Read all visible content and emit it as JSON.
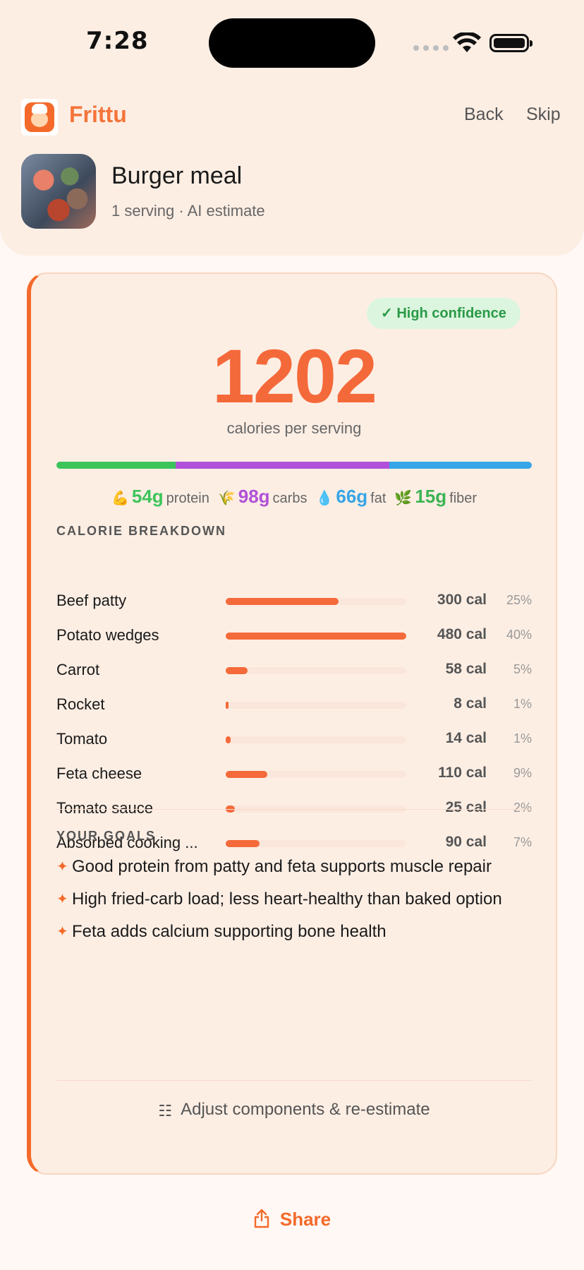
{
  "status": {
    "time": "7:28"
  },
  "app": {
    "name": "Frittu",
    "back_label": "Back",
    "skip_label": "Skip"
  },
  "meal": {
    "title": "Burger meal",
    "subtitle": "1 serving · AI estimate"
  },
  "card": {
    "confidence": "✓ High confidence",
    "calories": "1202",
    "calories_label": "calories per serving"
  },
  "macro_bar": [
    {
      "name": "protein",
      "color": "#3cc45a",
      "fraction": 0.25
    },
    {
      "name": "carbs",
      "color": "#b151d9",
      "fraction": 0.45
    },
    {
      "name": "fat",
      "color": "#37a5e6",
      "fraction": 0.3
    }
  ],
  "macros": [
    {
      "icon": "💪",
      "value": "54g",
      "label": "protein",
      "color": "#3cc45a"
    },
    {
      "icon": "🌾",
      "value": "98g",
      "label": "carbs",
      "color": "#b151d9"
    },
    {
      "icon": "💧",
      "value": "66g",
      "label": "fat",
      "color": "#37a5e6"
    },
    {
      "icon": "🌿",
      "value": "15g",
      "label": "fiber",
      "color": "#3cb454"
    }
  ],
  "breakdown": {
    "title": "CALORIE BREAKDOWN",
    "items": [
      {
        "name": "Beef patty",
        "cal": "300 cal",
        "pct": "25%",
        "fraction": 0.625
      },
      {
        "name": "Potato wedges",
        "cal": "480 cal",
        "pct": "40%",
        "fraction": 1.0
      },
      {
        "name": "Carrot",
        "cal": "58 cal",
        "pct": "5%",
        "fraction": 0.12
      },
      {
        "name": "Rocket",
        "cal": "8 cal",
        "pct": "1%",
        "fraction": 0.017
      },
      {
        "name": "Tomato",
        "cal": "14 cal",
        "pct": "1%",
        "fraction": 0.029
      },
      {
        "name": "Feta cheese",
        "cal": "110 cal",
        "pct": "9%",
        "fraction": 0.229
      },
      {
        "name": "Tomato sauce",
        "cal": "25 cal",
        "pct": "2%",
        "fraction": 0.052
      },
      {
        "name": "Absorbed cooking ...",
        "cal": "90 cal",
        "pct": "7%",
        "fraction": 0.1875
      }
    ]
  },
  "goals": {
    "title": "YOUR GOALS",
    "items": [
      "Good protein from patty and feta supports muscle repair",
      "High fried-carb load; less heart-healthy than baked option",
      "Feta adds calcium supporting bone health"
    ]
  },
  "adjust_label": "Adjust components & re-estimate",
  "share_label": "Share"
}
